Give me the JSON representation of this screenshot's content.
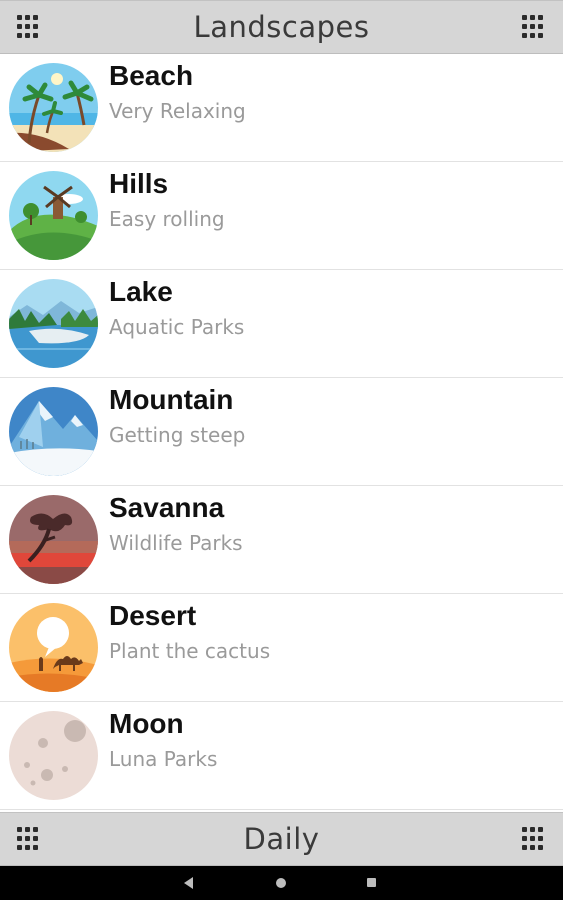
{
  "header": {
    "title": "Landscapes",
    "left_icon": "grid-menu-icon",
    "right_icon": "grid-menu-icon"
  },
  "items": [
    {
      "title": "Beach",
      "subtitle": "Very Relaxing",
      "icon": "beach-icon"
    },
    {
      "title": "Hills",
      "subtitle": "Easy rolling",
      "icon": "hills-icon"
    },
    {
      "title": "Lake",
      "subtitle": "Aquatic Parks",
      "icon": "lake-icon"
    },
    {
      "title": "Mountain",
      "subtitle": "Getting steep",
      "icon": "mountain-icon"
    },
    {
      "title": "Savanna",
      "subtitle": "Wildlife Parks",
      "icon": "savanna-icon"
    },
    {
      "title": "Desert",
      "subtitle": "Plant the cactus",
      "icon": "desert-icon"
    },
    {
      "title": "Moon",
      "subtitle": "Luna Parks",
      "icon": "moon-icon"
    }
  ],
  "footer": {
    "title": "Daily",
    "left_icon": "grid-menu-icon",
    "right_icon": "grid-menu-icon"
  },
  "navbar": {
    "back_icon": "back-triangle-icon",
    "home_icon": "home-circle-icon",
    "recents_icon": "recents-square-icon"
  },
  "colors": {
    "bar_bg": "#d6d6d6",
    "title_text": "#111111",
    "subtitle_text": "#9a9a9a"
  }
}
